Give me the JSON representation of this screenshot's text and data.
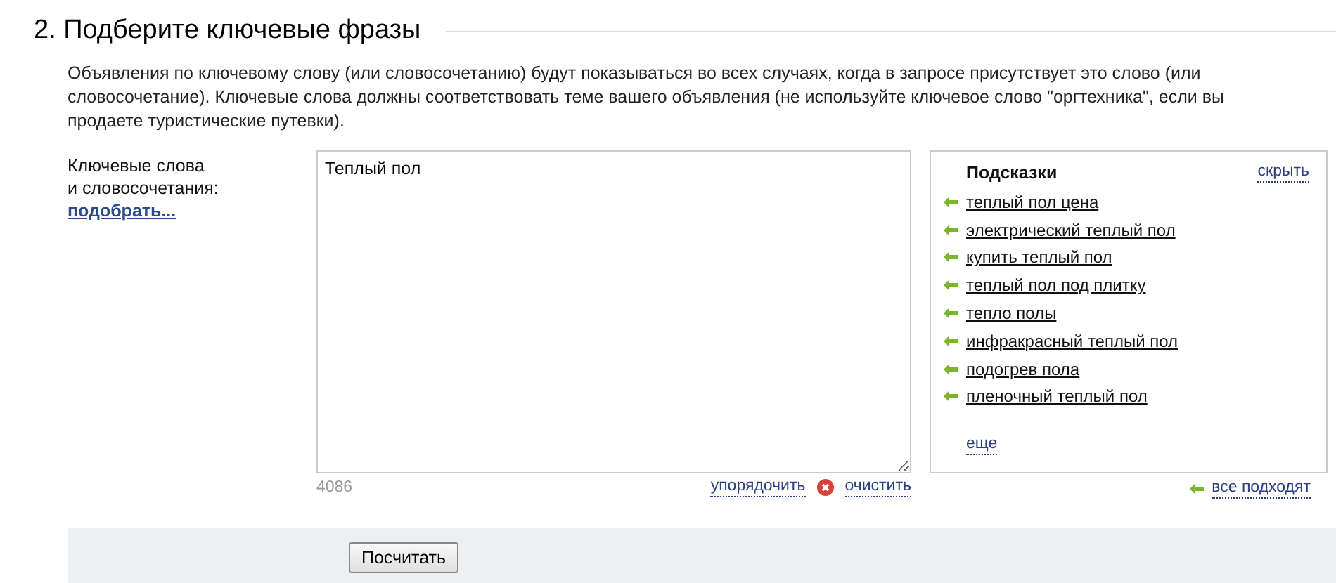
{
  "heading": "2. Подберите ключевые фразы",
  "description": "Объявления по ключевому слову (или словосочетанию) будут показываться во всех случаях, когда в запросе присутствует это слово (или словосочетание). Ключевые слова должны соответствовать теме вашего объявления (не используйте ключевое слово \"оргтехника\", если вы продаете туристические путевки).",
  "keywords_label": [
    "Ключевые слова",
    "и словосочетания:"
  ],
  "pick_link": "подобрать...",
  "keywords_field": {
    "value": "Теплый пол",
    "counter": "4086"
  },
  "field_actions": {
    "sort": "упорядочить",
    "clear": "очистить"
  },
  "hints": {
    "title": "Подсказки",
    "hide": "скрыть",
    "items": [
      {
        "text": "теплый пол цена"
      },
      {
        "text": "электрический теплый пол"
      },
      {
        "text": "купить теплый пол"
      },
      {
        "text": "теплый пол под плитку"
      },
      {
        "text": "тепло полы"
      },
      {
        "text": "инфракрасный теплый пол"
      },
      {
        "text": "подогрев пола"
      },
      {
        "text": "пленочный теплый пол"
      }
    ],
    "more": "еще",
    "all_fit": "все подходят"
  },
  "submit_button": "Посчитать"
}
